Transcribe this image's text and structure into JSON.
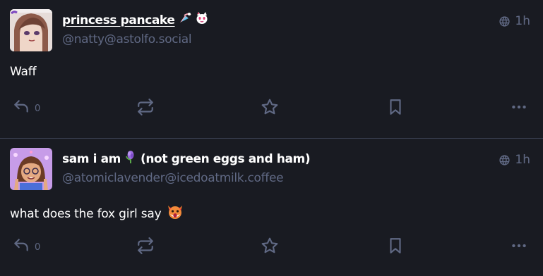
{
  "posts": [
    {
      "display_name": "princess pancake",
      "account": "@natty@astolfo.social",
      "timestamp": "1h",
      "content": "Waff",
      "reply_count": "0",
      "emoji": [
        "trans-flag-emoji",
        "cat-face-emoji"
      ]
    },
    {
      "display_name": "sam i am",
      "display_name_suffix": "(not green eggs and ham)",
      "account": "@atomiclavender@icedoatmilk.coffee",
      "timestamp": "1h",
      "content": "what does the fox girl say",
      "reply_count": "0",
      "emoji": [
        "lavender-flower-emoji",
        "fox-emoji"
      ]
    }
  ],
  "icons": {
    "visibility": "globe-icon",
    "reply": "reply-icon",
    "boost": "boost-icon",
    "favourite": "star-icon",
    "bookmark": "bookmark-icon",
    "more": "more-icon"
  },
  "colors": {
    "background": "#191b22",
    "text": "#ffffff",
    "muted": "#606984",
    "divider": "#393f4f"
  }
}
